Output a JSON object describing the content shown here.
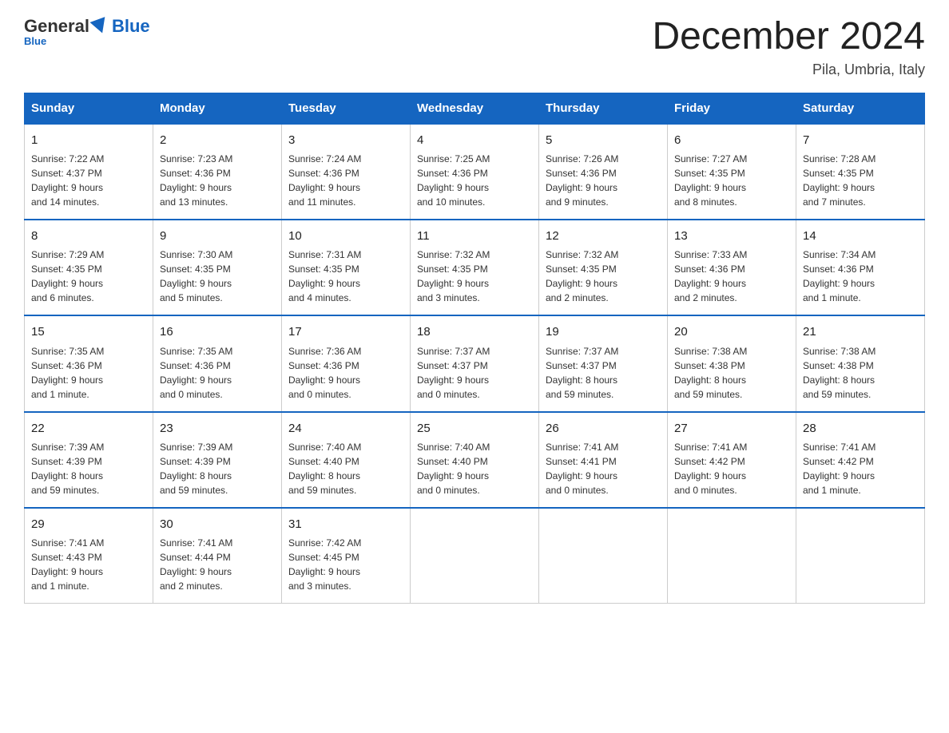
{
  "header": {
    "logo_general": "General",
    "logo_blue": "Blue",
    "month_title": "December 2024",
    "location": "Pila, Umbria, Italy"
  },
  "days_of_week": [
    "Sunday",
    "Monday",
    "Tuesday",
    "Wednesday",
    "Thursday",
    "Friday",
    "Saturday"
  ],
  "weeks": [
    [
      {
        "day": "1",
        "info": "Sunrise: 7:22 AM\nSunset: 4:37 PM\nDaylight: 9 hours\nand 14 minutes."
      },
      {
        "day": "2",
        "info": "Sunrise: 7:23 AM\nSunset: 4:36 PM\nDaylight: 9 hours\nand 13 minutes."
      },
      {
        "day": "3",
        "info": "Sunrise: 7:24 AM\nSunset: 4:36 PM\nDaylight: 9 hours\nand 11 minutes."
      },
      {
        "day": "4",
        "info": "Sunrise: 7:25 AM\nSunset: 4:36 PM\nDaylight: 9 hours\nand 10 minutes."
      },
      {
        "day": "5",
        "info": "Sunrise: 7:26 AM\nSunset: 4:36 PM\nDaylight: 9 hours\nand 9 minutes."
      },
      {
        "day": "6",
        "info": "Sunrise: 7:27 AM\nSunset: 4:35 PM\nDaylight: 9 hours\nand 8 minutes."
      },
      {
        "day": "7",
        "info": "Sunrise: 7:28 AM\nSunset: 4:35 PM\nDaylight: 9 hours\nand 7 minutes."
      }
    ],
    [
      {
        "day": "8",
        "info": "Sunrise: 7:29 AM\nSunset: 4:35 PM\nDaylight: 9 hours\nand 6 minutes."
      },
      {
        "day": "9",
        "info": "Sunrise: 7:30 AM\nSunset: 4:35 PM\nDaylight: 9 hours\nand 5 minutes."
      },
      {
        "day": "10",
        "info": "Sunrise: 7:31 AM\nSunset: 4:35 PM\nDaylight: 9 hours\nand 4 minutes."
      },
      {
        "day": "11",
        "info": "Sunrise: 7:32 AM\nSunset: 4:35 PM\nDaylight: 9 hours\nand 3 minutes."
      },
      {
        "day": "12",
        "info": "Sunrise: 7:32 AM\nSunset: 4:35 PM\nDaylight: 9 hours\nand 2 minutes."
      },
      {
        "day": "13",
        "info": "Sunrise: 7:33 AM\nSunset: 4:36 PM\nDaylight: 9 hours\nand 2 minutes."
      },
      {
        "day": "14",
        "info": "Sunrise: 7:34 AM\nSunset: 4:36 PM\nDaylight: 9 hours\nand 1 minute."
      }
    ],
    [
      {
        "day": "15",
        "info": "Sunrise: 7:35 AM\nSunset: 4:36 PM\nDaylight: 9 hours\nand 1 minute."
      },
      {
        "day": "16",
        "info": "Sunrise: 7:35 AM\nSunset: 4:36 PM\nDaylight: 9 hours\nand 0 minutes."
      },
      {
        "day": "17",
        "info": "Sunrise: 7:36 AM\nSunset: 4:36 PM\nDaylight: 9 hours\nand 0 minutes."
      },
      {
        "day": "18",
        "info": "Sunrise: 7:37 AM\nSunset: 4:37 PM\nDaylight: 9 hours\nand 0 minutes."
      },
      {
        "day": "19",
        "info": "Sunrise: 7:37 AM\nSunset: 4:37 PM\nDaylight: 8 hours\nand 59 minutes."
      },
      {
        "day": "20",
        "info": "Sunrise: 7:38 AM\nSunset: 4:38 PM\nDaylight: 8 hours\nand 59 minutes."
      },
      {
        "day": "21",
        "info": "Sunrise: 7:38 AM\nSunset: 4:38 PM\nDaylight: 8 hours\nand 59 minutes."
      }
    ],
    [
      {
        "day": "22",
        "info": "Sunrise: 7:39 AM\nSunset: 4:39 PM\nDaylight: 8 hours\nand 59 minutes."
      },
      {
        "day": "23",
        "info": "Sunrise: 7:39 AM\nSunset: 4:39 PM\nDaylight: 8 hours\nand 59 minutes."
      },
      {
        "day": "24",
        "info": "Sunrise: 7:40 AM\nSunset: 4:40 PM\nDaylight: 8 hours\nand 59 minutes."
      },
      {
        "day": "25",
        "info": "Sunrise: 7:40 AM\nSunset: 4:40 PM\nDaylight: 9 hours\nand 0 minutes."
      },
      {
        "day": "26",
        "info": "Sunrise: 7:41 AM\nSunset: 4:41 PM\nDaylight: 9 hours\nand 0 minutes."
      },
      {
        "day": "27",
        "info": "Sunrise: 7:41 AM\nSunset: 4:42 PM\nDaylight: 9 hours\nand 0 minutes."
      },
      {
        "day": "28",
        "info": "Sunrise: 7:41 AM\nSunset: 4:42 PM\nDaylight: 9 hours\nand 1 minute."
      }
    ],
    [
      {
        "day": "29",
        "info": "Sunrise: 7:41 AM\nSunset: 4:43 PM\nDaylight: 9 hours\nand 1 minute."
      },
      {
        "day": "30",
        "info": "Sunrise: 7:41 AM\nSunset: 4:44 PM\nDaylight: 9 hours\nand 2 minutes."
      },
      {
        "day": "31",
        "info": "Sunrise: 7:42 AM\nSunset: 4:45 PM\nDaylight: 9 hours\nand 3 minutes."
      },
      null,
      null,
      null,
      null
    ]
  ]
}
